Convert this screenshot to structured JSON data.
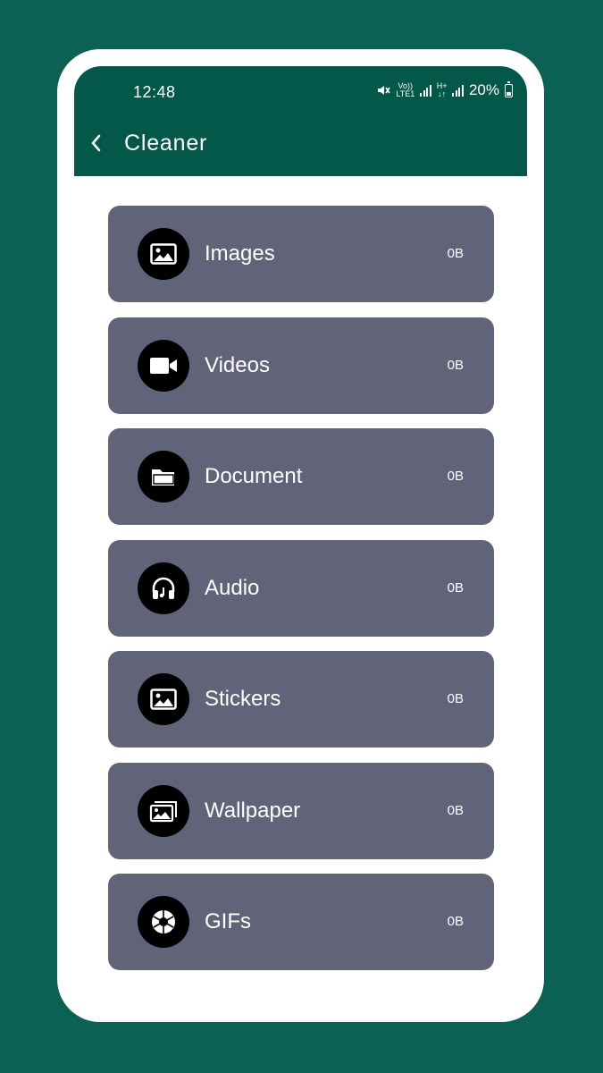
{
  "status_bar": {
    "time": "12:48",
    "volte_top": "Vo))",
    "volte_bottom": "LTE1",
    "network_top": "H+",
    "network_bottom": "↓↑",
    "battery": "20%"
  },
  "appbar": {
    "title": "Cleaner",
    "color": "#04584a"
  },
  "categories": [
    {
      "label": "Images",
      "size": "0B",
      "icon": "image-icon"
    },
    {
      "label": "Videos",
      "size": "0B",
      "icon": "video-camera-icon"
    },
    {
      "label": "Document",
      "size": "0B",
      "icon": "folder-icon"
    },
    {
      "label": "Audio",
      "size": "0B",
      "icon": "headphones-icon"
    },
    {
      "label": "Stickers",
      "size": "0B",
      "icon": "sticker-image-icon"
    },
    {
      "label": "Wallpaper",
      "size": "0B",
      "icon": "wallpaper-icon"
    },
    {
      "label": "GIFs",
      "size": "0B",
      "icon": "shutter-icon"
    }
  ],
  "colors": {
    "background": "#0a6154",
    "card": "#616379",
    "icon_circle": "#000000"
  }
}
